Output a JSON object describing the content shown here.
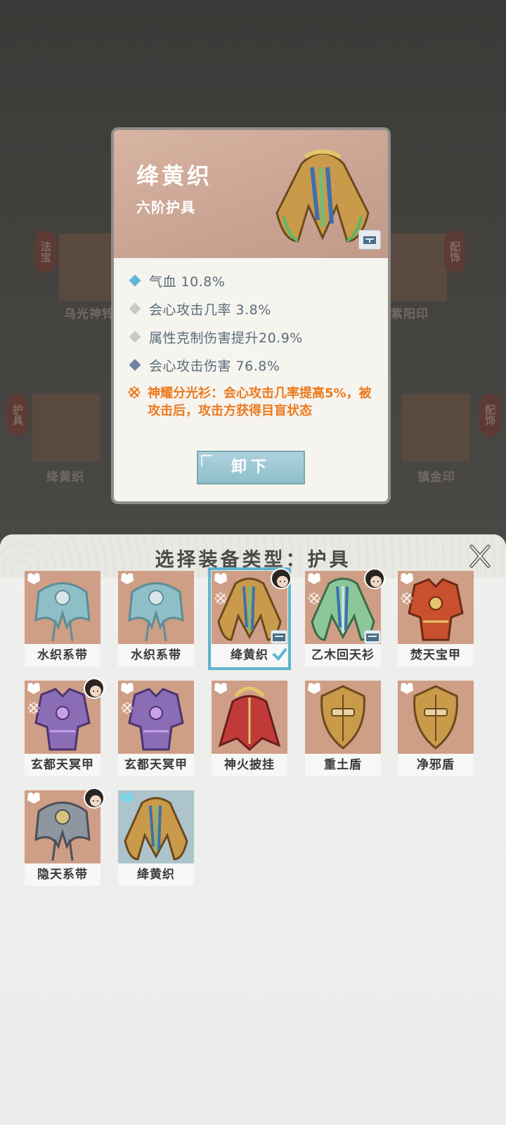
{
  "background": {
    "slots": [
      {
        "name": "乌光神铃",
        "tag": "法宝"
      },
      {
        "name": "紫阳印",
        "tag": "配饰"
      },
      {
        "name": "绛黄织",
        "tag": "护具"
      },
      {
        "name": "镇金印",
        "tag": "配饰"
      }
    ]
  },
  "detail": {
    "title": "绛黄织",
    "subtitle": "六阶护具",
    "attributes": [
      {
        "text": "气血 10.8%",
        "color": "#5fb4dc"
      },
      {
        "text": "会心攻击几率 3.8%",
        "color": "#c9c9c9"
      },
      {
        "text": "属性克制伤害提升20.9%",
        "color": "#c9c9c9"
      },
      {
        "text": "会心攻击伤害 76.8%",
        "color": "#6f86a0"
      }
    ],
    "skill": "神耀分光衫：会心攻击几率提高5%，被攻击后，攻击方获得目盲状态",
    "unequip_label": "卸下"
  },
  "panel": {
    "title": "选择装备类型：护具",
    "close_label": "X",
    "items": [
      {
        "name": "水织系带",
        "icon": "sash-icon"
      },
      {
        "name": "水织系带",
        "icon": "sash-icon"
      },
      {
        "name": "绛黄织",
        "icon": "robe-icon",
        "selected": true
      },
      {
        "name": "乙木回天衫",
        "icon": "robe-icon"
      },
      {
        "name": "焚天宝甲",
        "icon": "armor-icon"
      },
      {
        "name": "玄都天冥甲",
        "icon": "armor-icon"
      },
      {
        "name": "玄都天冥甲",
        "icon": "armor-icon"
      },
      {
        "name": "神火披挂",
        "icon": "cloak-icon"
      },
      {
        "name": "重土盾",
        "icon": "shield-icon"
      },
      {
        "name": "净邪盾",
        "icon": "shield-icon"
      },
      {
        "name": "隐天系带",
        "icon": "sash-icon"
      },
      {
        "name": "绛黄织",
        "icon": "robe-icon"
      }
    ]
  },
  "colors": {
    "accent": "#5fb4cf",
    "skill": "#ec7a1d",
    "item_bg": "#cf9e86"
  }
}
